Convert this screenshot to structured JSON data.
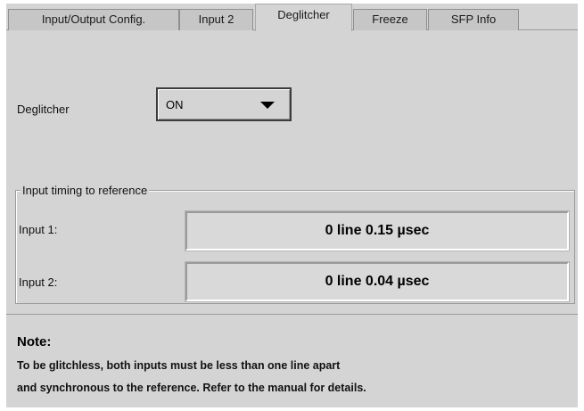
{
  "tabs": [
    {
      "label": "Input/Output Config.",
      "active": false
    },
    {
      "label": "Input 2",
      "active": false
    },
    {
      "label": "Deglitcher",
      "active": true
    },
    {
      "label": "Freeze",
      "active": false
    },
    {
      "label": "SFP Info",
      "active": false
    }
  ],
  "deglitcher": {
    "label": "Deglitcher",
    "value": "ON"
  },
  "timing": {
    "title": "Input timing to reference",
    "rows": [
      {
        "label": "Input 1:",
        "value": "0 line 0.15 µsec"
      },
      {
        "label": "Input 2:",
        "value": "0 line 0.04 µsec"
      }
    ]
  },
  "note": {
    "title": "Note:",
    "lines": [
      "To be glitchless, both inputs must be less than one line apart",
      "and synchronous to the reference. Refer to the manual for details."
    ]
  },
  "colors": {
    "panel": "#d4d4d4",
    "tab_inactive": "#c6c6c6"
  }
}
